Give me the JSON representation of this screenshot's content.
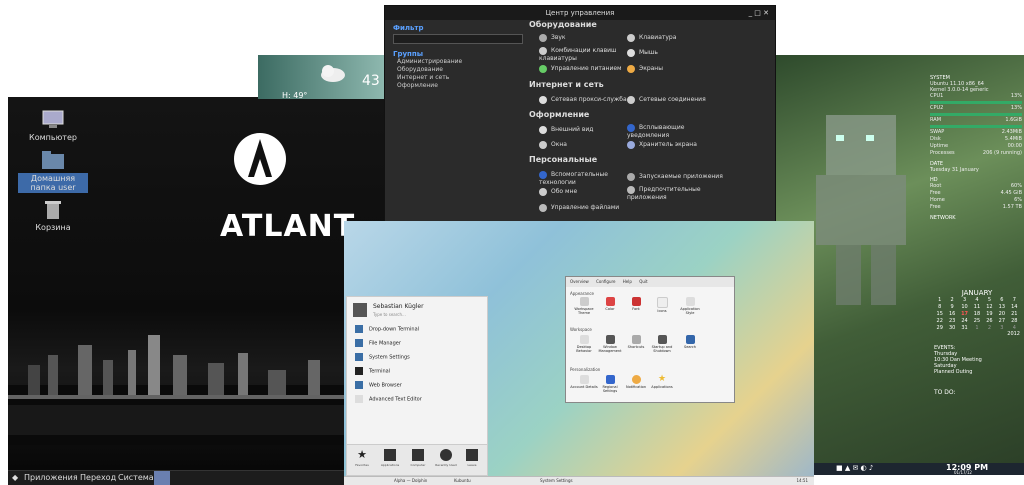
{
  "atlant": {
    "brand": "ATLANT",
    "icons": [
      {
        "label": "Компьютер"
      },
      {
        "label": "Домашняя папка user"
      },
      {
        "label": "Корзина"
      }
    ],
    "panel": {
      "apps": "Приложения",
      "go": "Переход",
      "system": "Система"
    }
  },
  "weather": {
    "temp": "43",
    "hum": "H: 49°"
  },
  "cc": {
    "title": "Центр управления",
    "filter": "Фильтр",
    "groups": "Группы",
    "group_items": [
      "Администрирование",
      "Оборудование",
      "Интернет и сеть",
      "Оформление"
    ],
    "sections": {
      "hardware": "Оборудование",
      "net": "Интернет и сеть",
      "look": "Оформление",
      "personal": "Персональные"
    },
    "items": {
      "sound": "Звук",
      "keyboard": "Клавиатура",
      "shortcuts": "Комбинации клавиш клавиатуры",
      "mouse": "Мышь",
      "power": "Управление питанием",
      "screens": "Экраны",
      "proxy": "Сетевая прокси-служба",
      "connections": "Сетевые соединения",
      "appearance": "Внешний вид",
      "notifications": "Всплывающие уведомления",
      "windows": "Окна",
      "screensaver": "Хранитель экрана",
      "a11y": "Вспомогательные технологии",
      "startup": "Запускаемые приложения",
      "about": "Обо мне",
      "preferred": "Предпочтительные приложения",
      "files": "Управление файлами"
    }
  },
  "conky": {
    "system_h": "SYSTEM",
    "host": "Ubuntu 11.10 x86_64",
    "kernel": "Kernel 3.0.0-14 generic",
    "rows": [
      [
        "CPU1",
        "13%"
      ],
      [
        "CPU2",
        "13%"
      ],
      [
        "RAM",
        "1.6GiB"
      ],
      [
        "SWAP",
        "2.43MiB"
      ],
      [
        "Disk",
        "5.4MiB"
      ],
      [
        "Uptime",
        "00:00"
      ],
      [
        "Processes",
        "206 (9 running)"
      ]
    ],
    "date_h": "DATE",
    "date": "Tuesday 31 January",
    "hd_h": "HD",
    "hd": [
      [
        "Root",
        "60%"
      ],
      [
        "Free",
        "4.45 GiB"
      ],
      [
        "Home",
        "6%"
      ],
      [
        "Free",
        "1.57 TB"
      ]
    ],
    "network_h": "NETWORK",
    "cal_month": "JANUARY",
    "cal_year": "2012",
    "cal_days": [
      "1",
      "2",
      "3",
      "4",
      "5",
      "6",
      "7",
      "8",
      "9",
      "10",
      "11",
      "12",
      "13",
      "14",
      "15",
      "16",
      "17",
      "18",
      "19",
      "20",
      "21",
      "22",
      "23",
      "24",
      "25",
      "26",
      "27",
      "28",
      "29",
      "30",
      "31",
      "1",
      "2",
      "3",
      "4"
    ],
    "events_h": "EVENTS:",
    "events": [
      "Thursday",
      "10:30 Dan Meeting",
      "Saturday",
      "Planned Outing"
    ],
    "todo": "TO DO:",
    "time": "12:09 PM",
    "tdate": "01/17/12"
  },
  "kde": {
    "user": "Sebastian Kügler",
    "search": "Type to search...",
    "menu": [
      "Drop-down Terminal",
      "File Manager",
      "System Settings",
      "Terminal",
      "Web Browser",
      "Advanced Text Editor"
    ],
    "tabs": [
      "Favorites",
      "Applications",
      "Computer",
      "Recently Used",
      "Leave"
    ],
    "settings": {
      "toolbar": [
        "Overview",
        "Configure",
        "Help",
        "Quit"
      ],
      "sections": [
        "Appearance",
        "Workspace",
        "Personalization"
      ],
      "appearance": [
        "Workspace Theme",
        "Color",
        "Font",
        "Icons",
        "Application Style"
      ],
      "workspace": [
        "Desktop Behavior",
        "Window Management",
        "Shortcuts",
        "Startup and Shutdown",
        "Search"
      ],
      "personal": [
        "Account Details",
        "Regional Settings",
        "Notification",
        "Applications"
      ]
    },
    "panel": [
      "Alpha — Dolphin",
      "Kubuntu",
      "System Settings",
      "14:51"
    ]
  }
}
